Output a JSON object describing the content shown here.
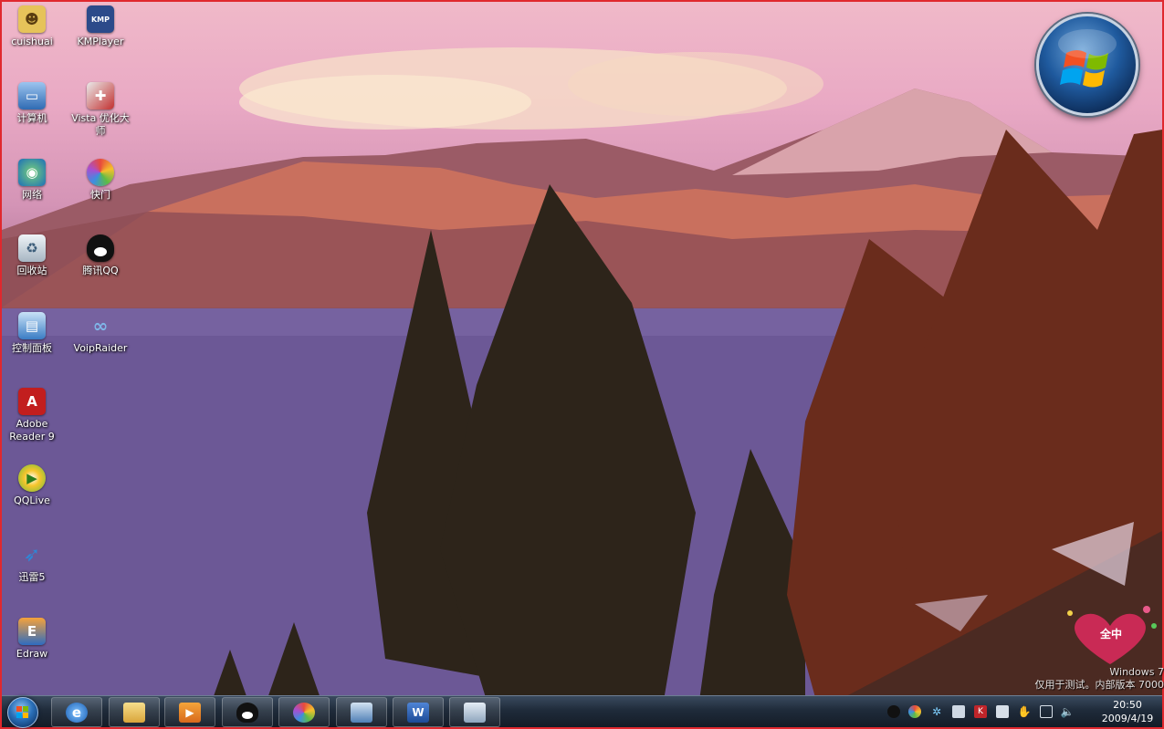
{
  "desktop": {
    "icons": [
      {
        "label": "cuishuai",
        "icon": "user-folder-icon"
      },
      {
        "label": "KMPlayer",
        "icon": "kmplayer-icon",
        "badge": "KMP"
      },
      {
        "label": "计算机",
        "icon": "computer-icon"
      },
      {
        "label": "Vista 优化大师",
        "icon": "vista-optimizer-icon"
      },
      {
        "label": "网络",
        "icon": "network-icon"
      },
      {
        "label": "快门",
        "icon": "shutter-icon"
      },
      {
        "label": "回收站",
        "icon": "recycle-bin-icon"
      },
      {
        "label": "腾讯QQ",
        "icon": "qq-penguin-icon"
      },
      {
        "label": "控制面板",
        "icon": "control-panel-icon"
      },
      {
        "label": "VoipRaider",
        "icon": "voipraider-icon"
      },
      {
        "label": "Adobe Reader 9",
        "icon": "adobe-reader-icon"
      },
      {
        "label": "QQLive",
        "icon": "qqlive-icon"
      },
      {
        "label": "迅雷5",
        "icon": "xunlei-icon"
      },
      {
        "label": "Edraw",
        "icon": "edraw-icon"
      }
    ]
  },
  "watermark": {
    "line1": "Windows 7",
    "line2": "仅用于测试。内部版本 7000",
    "badge_text": "全中"
  },
  "taskbar": {
    "start_icon": "windows-start-orb-icon",
    "pinned": [
      {
        "name": "internet-explorer-icon",
        "glyph": "e"
      },
      {
        "name": "windows-explorer-icon",
        "glyph": ""
      },
      {
        "name": "media-player-icon",
        "glyph": "▶"
      },
      {
        "name": "qq-icon",
        "glyph": ""
      },
      {
        "name": "shutter-app-icon",
        "glyph": ""
      },
      {
        "name": "remote-desktop-icon",
        "glyph": ""
      },
      {
        "name": "word-icon",
        "glyph": "W"
      },
      {
        "name": "computer-app-icon",
        "glyph": ""
      }
    ],
    "tray_icons": [
      "qq-tray-icon",
      "colorwheel-tray-icon",
      "network-tray-icon",
      "device-tray-icon",
      "antivirus-tray-icon",
      "flag-tray-icon",
      "hand-tray-icon",
      "display-tray-icon",
      "volume-icon"
    ],
    "clock": {
      "time": "20:50",
      "date": "2009/4/19"
    }
  },
  "colors": {
    "frame_border": "#e0282e",
    "taskbar": "#1f2b3a",
    "sky": "#f0b9c9",
    "lake": "#6b5b92"
  }
}
